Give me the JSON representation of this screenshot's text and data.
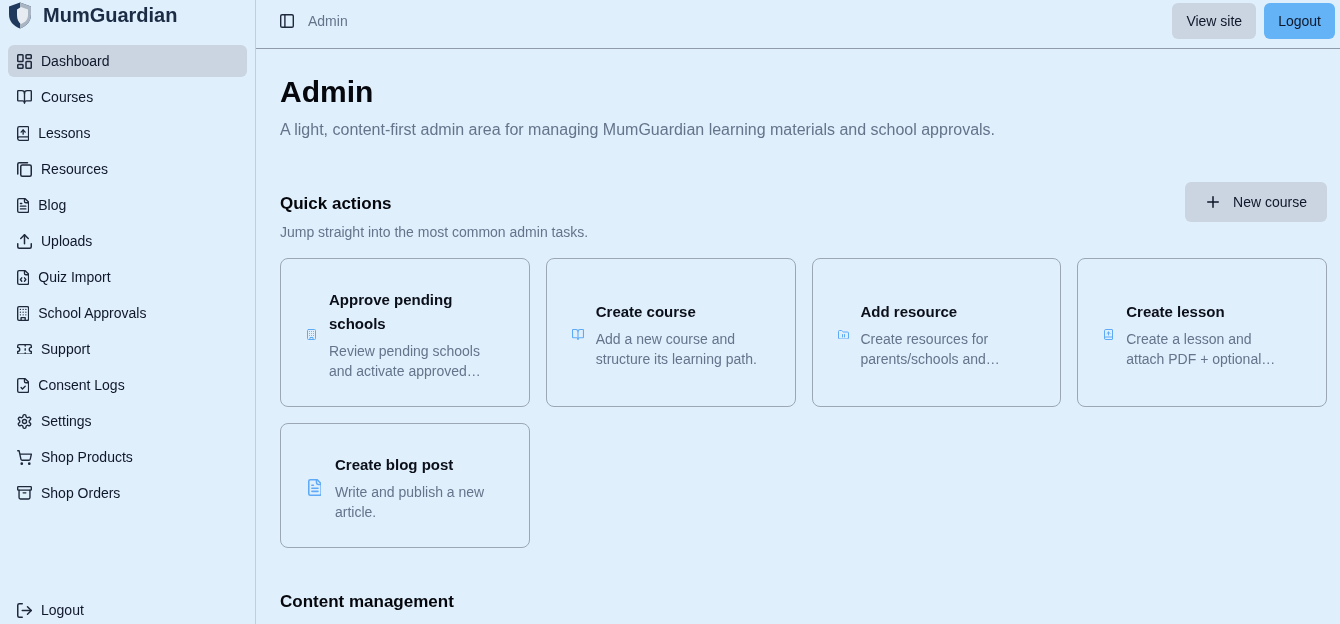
{
  "sidebar": {
    "brand": "MumGuardian",
    "items": [
      {
        "label": "Dashboard",
        "selected": true
      },
      {
        "label": "Courses",
        "selected": false
      },
      {
        "label": "Lessons",
        "selected": false
      },
      {
        "label": "Resources",
        "selected": false
      },
      {
        "label": "Blog",
        "selected": false
      },
      {
        "label": "Uploads",
        "selected": false
      },
      {
        "label": "Quiz Import",
        "selected": false
      },
      {
        "label": "School Approvals",
        "selected": false
      },
      {
        "label": "Support",
        "selected": false
      },
      {
        "label": "Consent Logs",
        "selected": false
      },
      {
        "label": "Settings",
        "selected": false
      },
      {
        "label": "Shop Products",
        "selected": false
      },
      {
        "label": "Shop Orders",
        "selected": false
      }
    ],
    "footer_item": {
      "label": "Logout"
    }
  },
  "header": {
    "breadcrumb": "Admin",
    "buttons": [
      {
        "label": "View site",
        "kind": "secondary"
      },
      {
        "label": "Logout",
        "kind": "primary"
      }
    ]
  },
  "page": {
    "title": "Admin",
    "subtitle": "A light, content-first admin area for managing MumGuardian learning materials and school approvals."
  },
  "quick_actions": {
    "title": "Quick actions",
    "subtitle": "Jump straight into the most common admin tasks.",
    "button": {
      "label": "New course"
    },
    "cards": [
      {
        "title": "Approve pending schools",
        "description": "Review pending schools and activate approved…"
      },
      {
        "title": "Create course",
        "description": "Add a new course and structure its learning path."
      },
      {
        "title": "Add resource",
        "description": "Create resources for parents/schools and…"
      },
      {
        "title": "Create lesson",
        "description": "Create a lesson and attach PDF + optional…"
      },
      {
        "title": "Create blog post",
        "description": "Write and publish a new article."
      }
    ]
  },
  "content_management": {
    "title": "Content management"
  }
}
